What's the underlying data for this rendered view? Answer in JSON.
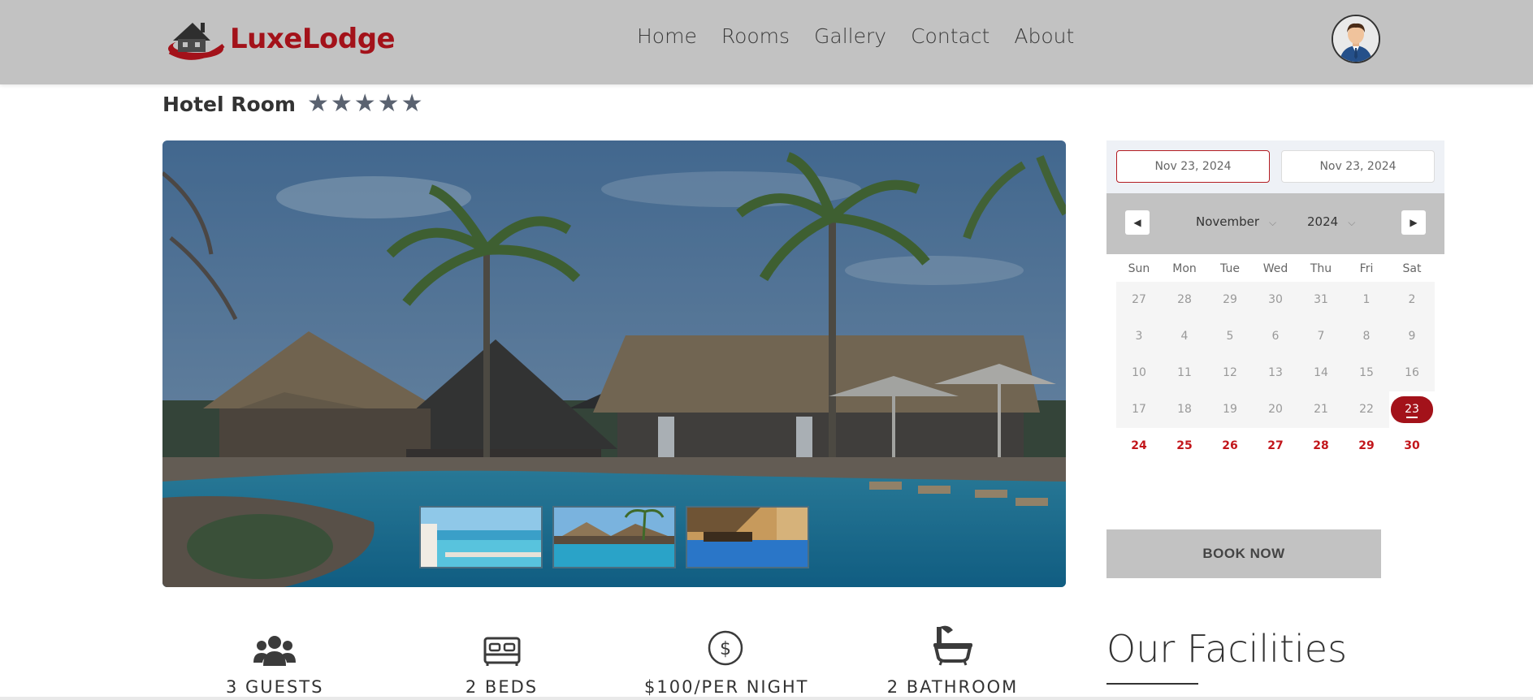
{
  "brand": {
    "name": "LuxeLodge",
    "color": "#a3121a"
  },
  "nav": {
    "items": [
      "Home",
      "Rooms",
      "Gallery",
      "Contact",
      "About"
    ]
  },
  "header": {
    "bg": "#c2c2c2"
  },
  "title": "Hotel Room",
  "rating": {
    "stars": 5,
    "max": 5
  },
  "datepicker": {
    "checkin": "Nov 23, 2024",
    "checkout": "Nov 23, 2024",
    "month": "November",
    "year": "2024",
    "weekdays": [
      "Sun",
      "Mon",
      "Tue",
      "Wed",
      "Thu",
      "Fri",
      "Sat"
    ],
    "weeks": [
      [
        "27",
        "28",
        "29",
        "30",
        "31",
        "1",
        "2"
      ],
      [
        "3",
        "4",
        "5",
        "6",
        "7",
        "8",
        "9"
      ],
      [
        "10",
        "11",
        "12",
        "13",
        "14",
        "15",
        "16"
      ],
      [
        "17",
        "18",
        "19",
        "20",
        "21",
        "22",
        "23"
      ],
      [
        "24",
        "25",
        "26",
        "27",
        "28",
        "29",
        "30"
      ]
    ],
    "selected": "23",
    "accent": "#a3121a"
  },
  "book_button": "BOOK NOW",
  "features": [
    {
      "icon": "users-icon",
      "label": "3 GUESTS"
    },
    {
      "icon": "bed-icon",
      "label": "2 BEDS"
    },
    {
      "icon": "dollar-icon",
      "label": "$100/PER NIGHT"
    },
    {
      "icon": "bathtub-icon",
      "label": "2 BATHROOM"
    }
  ],
  "facilities_heading": "Our Facilities"
}
